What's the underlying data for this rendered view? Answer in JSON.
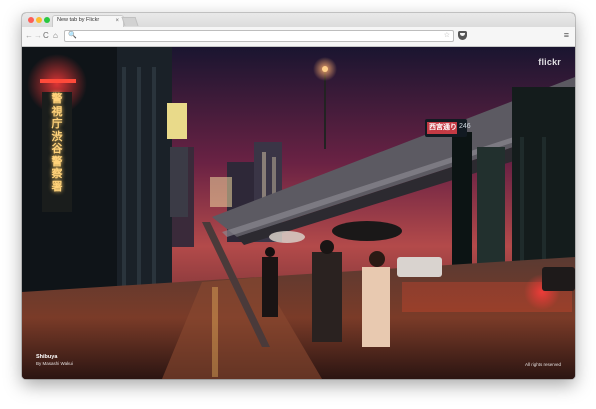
{
  "browser": {
    "tab_title": "New tab by Flickr",
    "tab_close": "×",
    "omnibox_value": "",
    "search_glyph": "🔍",
    "star_glyph": "☆",
    "menu_glyph": "≡",
    "nav": {
      "back": "←",
      "forward": "→",
      "reload": "C",
      "home": "⌂"
    }
  },
  "page": {
    "brand": "flickr",
    "photo_title": "Shibuya",
    "photo_credit": "By Masashi Wakui",
    "rights": "All rights reserved"
  },
  "signs": {
    "vertical": [
      "警",
      "視",
      "庁",
      "渋",
      "谷",
      "警",
      "察",
      "署"
    ],
    "street": "西宮通り",
    "route": "246"
  },
  "colors": {
    "accent_red": "#e0373d",
    "neon_yellow": "#ffd27a",
    "sky_magenta": "#a32b57"
  }
}
